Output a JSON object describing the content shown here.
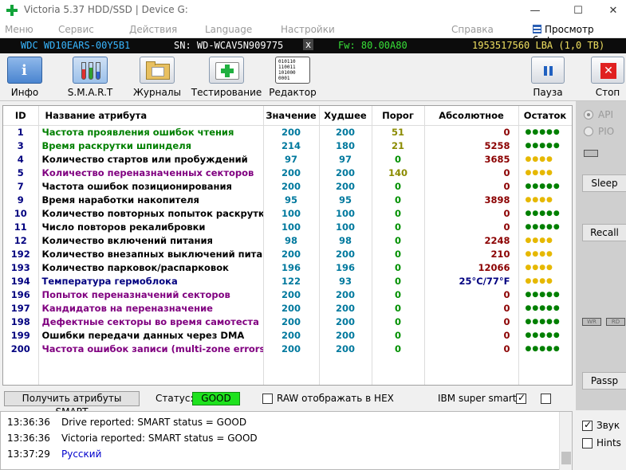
{
  "window": {
    "title": "Victoria 5.37 HDD/SSD | Device G:",
    "minimize": "—",
    "maximize": "☐",
    "close": "✕"
  },
  "menu": {
    "items": [
      "Меню",
      "Сервис",
      "Действия",
      "Language",
      "Настройки",
      "Справка"
    ],
    "buffer_view": "Просмотр буфера"
  },
  "device": {
    "model": "WDC WD10EARS-00Y5B1",
    "serial": "SN: WD-WCAV5N909775",
    "eject": "x",
    "firmware": "Fw: 80.00A80",
    "lba": "1953517560 LBA (1,0 TB)"
  },
  "toolbar": {
    "info": "Инфо",
    "smart": "S.M.A.R.T",
    "logs": "Журналы",
    "testing": "Тестирование",
    "editor": "Редактор",
    "pause": "Пауза",
    "stop": "Стоп",
    "info_icon_text": "i",
    "editor_icon_text": [
      "010110",
      "110011",
      "101000",
      "0001"
    ]
  },
  "table": {
    "headers": [
      "ID",
      "Название атрибута",
      "Значение",
      "Худшее",
      "Порог",
      "Абсолютное",
      "Остаток"
    ],
    "rows": [
      {
        "id": "1",
        "name": "Частота проявления ошибок чтения",
        "value": "200",
        "worst": "200",
        "threshold": "51",
        "raw": "0",
        "health": "●●●●●",
        "name_color": "#008000",
        "health_color": "#008000",
        "threshold_color": "#8b8b00"
      },
      {
        "id": "3",
        "name": "Время раскрутки шпинделя",
        "value": "214",
        "worst": "180",
        "threshold": "21",
        "raw": "5258",
        "health": "●●●●●",
        "name_color": "#008000",
        "health_color": "#008000",
        "threshold_color": "#8b8b00"
      },
      {
        "id": "4",
        "name": "Количество стартов или пробуждений",
        "value": "97",
        "worst": "97",
        "threshold": "0",
        "raw": "3685",
        "health": "●●●●",
        "name_color": "#000000",
        "health_color": "#e6b800",
        "threshold_color": "#009000"
      },
      {
        "id": "5",
        "name": "Количество переназначенных секторов",
        "value": "200",
        "worst": "200",
        "threshold": "140",
        "raw": "0",
        "health": "●●●●",
        "name_color": "#800080",
        "health_color": "#e6b800",
        "threshold_color": "#8b8b00"
      },
      {
        "id": "7",
        "name": "Частота ошибок позиционирования",
        "value": "200",
        "worst": "200",
        "threshold": "0",
        "raw": "0",
        "health": "●●●●●",
        "name_color": "#000000",
        "health_color": "#008000",
        "threshold_color": "#009000"
      },
      {
        "id": "9",
        "name": "Время наработки накопителя",
        "value": "95",
        "worst": "95",
        "threshold": "0",
        "raw": "3898",
        "health": "●●●●",
        "name_color": "#000000",
        "health_color": "#e6b800",
        "threshold_color": "#009000"
      },
      {
        "id": "10",
        "name": "Количество повторных попыток раскрутки",
        "value": "100",
        "worst": "100",
        "threshold": "0",
        "raw": "0",
        "health": "●●●●●",
        "name_color": "#000000",
        "health_color": "#008000",
        "threshold_color": "#009000"
      },
      {
        "id": "11",
        "name": "Число повторов рекалибровки",
        "value": "100",
        "worst": "100",
        "threshold": "0",
        "raw": "0",
        "health": "●●●●●",
        "name_color": "#000000",
        "health_color": "#008000",
        "threshold_color": "#009000"
      },
      {
        "id": "12",
        "name": "Количество включений питания",
        "value": "98",
        "worst": "98",
        "threshold": "0",
        "raw": "2248",
        "health": "●●●●",
        "name_color": "#000000",
        "health_color": "#e6b800",
        "threshold_color": "#009000"
      },
      {
        "id": "192",
        "name": "Количество внезапных выключений питания",
        "value": "200",
        "worst": "200",
        "threshold": "0",
        "raw": "210",
        "health": "●●●●",
        "name_color": "#000000",
        "health_color": "#e6b800",
        "threshold_color": "#009000"
      },
      {
        "id": "193",
        "name": "Количество парковок/распарковок",
        "value": "196",
        "worst": "196",
        "threshold": "0",
        "raw": "12066",
        "health": "●●●●",
        "name_color": "#000000",
        "health_color": "#e6b800",
        "threshold_color": "#009000"
      },
      {
        "id": "194",
        "name": "Температура гермоблока",
        "value": "122",
        "worst": "93",
        "threshold": "0",
        "raw": "25°C/77°F",
        "health": "●●●●",
        "name_color": "#000080",
        "health_color": "#e6b800",
        "threshold_color": "#009000",
        "temp": true
      },
      {
        "id": "196",
        "name": "Попыток переназначений секторов",
        "value": "200",
        "worst": "200",
        "threshold": "0",
        "raw": "0",
        "health": "●●●●●",
        "name_color": "#800080",
        "health_color": "#008000",
        "threshold_color": "#009000"
      },
      {
        "id": "197",
        "name": "Кандидатов на переназначение",
        "value": "200",
        "worst": "200",
        "threshold": "0",
        "raw": "0",
        "health": "●●●●●",
        "name_color": "#800080",
        "health_color": "#008000",
        "threshold_color": "#009000"
      },
      {
        "id": "198",
        "name": "Дефектные секторы во время самотеста",
        "value": "200",
        "worst": "200",
        "threshold": "0",
        "raw": "0",
        "health": "●●●●●",
        "name_color": "#800080",
        "health_color": "#008000",
        "threshold_color": "#009000"
      },
      {
        "id": "199",
        "name": "Ошибки передачи данных через DMA",
        "value": "200",
        "worst": "200",
        "threshold": "0",
        "raw": "0",
        "health": "●●●●●",
        "name_color": "#000000",
        "health_color": "#008000",
        "threshold_color": "#009000"
      },
      {
        "id": "200",
        "name": "Частота ошибок записи (multi-zone errors)",
        "value": "200",
        "worst": "200",
        "threshold": "0",
        "raw": "0",
        "health": "●●●●●",
        "name_color": "#800080",
        "health_color": "#008000",
        "threshold_color": "#009000"
      }
    ]
  },
  "status": {
    "get_attrs_button": "Получить атрибуты SMART",
    "label": "Статус:",
    "value": "GOOD",
    "raw_hex": "RAW отображать в HEX",
    "ibm_super_smart": "IBM super smart:"
  },
  "log": [
    {
      "time": "13:36:36",
      "text": "Drive reported: SMART status = GOOD",
      "color": "#000000"
    },
    {
      "time": "13:36:36",
      "text": "Victoria reported: SMART status = GOOD",
      "color": "#000000"
    },
    {
      "time": "13:37:29",
      "text": "Русский",
      "color": "#0000cc"
    }
  ],
  "side": {
    "api": "API",
    "pio": "PIO",
    "sleep": "Sleep",
    "recall": "Recall",
    "wr": "WR",
    "rd": "RD",
    "passp": "Passp",
    "sound": "Звук",
    "hints": "Hints"
  }
}
